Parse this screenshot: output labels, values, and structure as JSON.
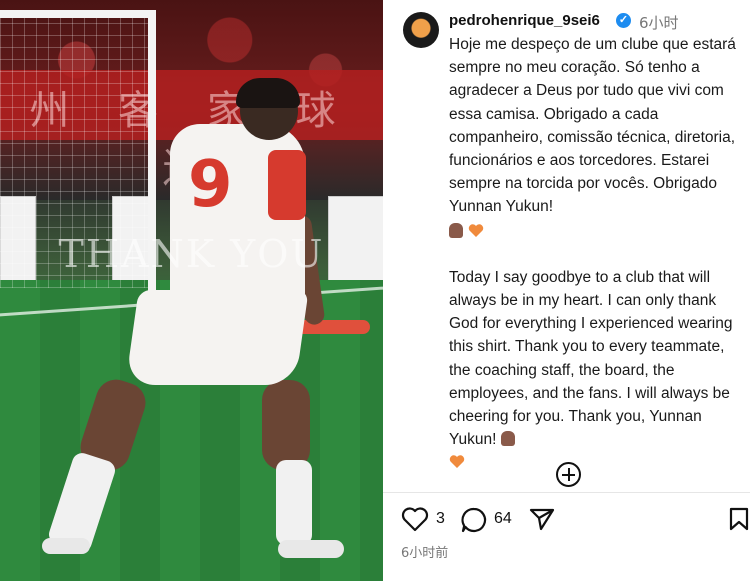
{
  "media": {
    "watermark": "THANK YOU",
    "banner_text": "州 客 家 球 迷",
    "jersey_number": "9"
  },
  "post": {
    "username": "pedrohenrique_9sei6",
    "verified": "✓",
    "time": "6小时",
    "caption_pt": "Hoje me despeço de um clube que estará sempre no meu coração. Só tenho a agradecer a Deus por tudo que vivi com essa camisa. Obrigado a cada companheiro, comissão técnica, diretoria, funcionários e aos torcedores. Estarei sempre na torcida por vocês. Obrigado Yunnan Yukun!",
    "caption_en": "Today I say goodbye to a club that will always be in my heart. I can only thank God for everything I experienced wearing this shirt. Thank you to every teammate, the coaching staff, the board, the employees, and the fans. I will always be cheering for you. Thank you, Yunnan Yukun!",
    "emoji_pray": "pray-emoji",
    "emoji_heart": "orange-heart-emoji",
    "like_count": "3",
    "comment_count": "64",
    "date": "6小时前"
  },
  "colors": {
    "heart": "#f08a3c",
    "verified": "#1d8cf0",
    "jersey_red": "#d63a2e"
  }
}
